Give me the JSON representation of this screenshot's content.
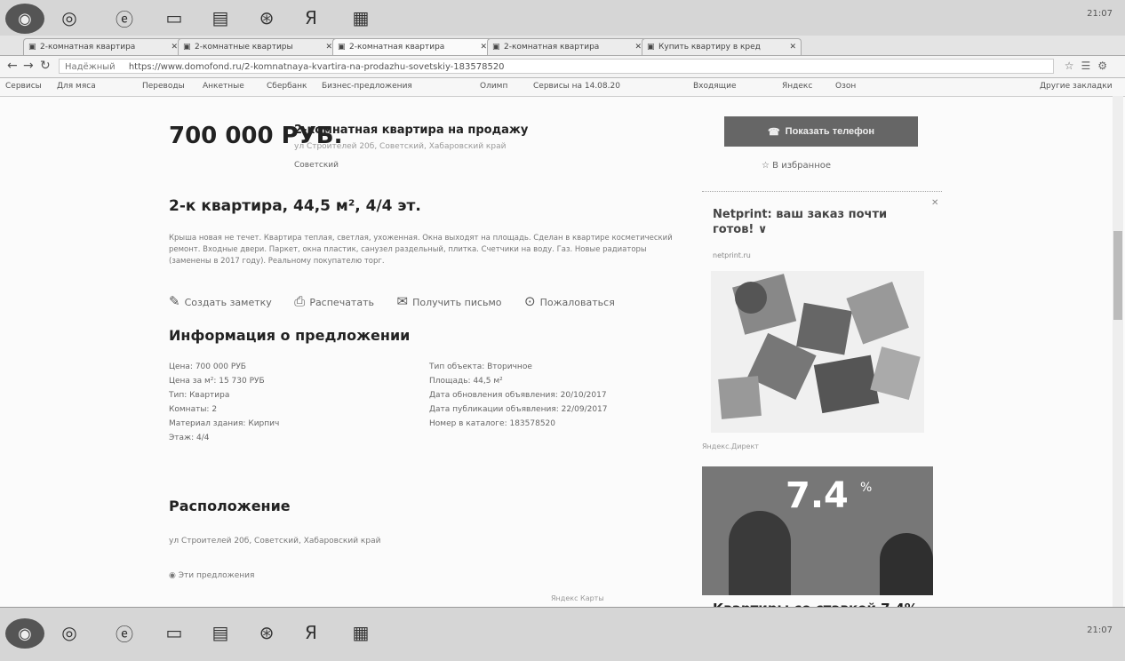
{
  "taskbar": {
    "icons": [
      "start-orb",
      "chrome",
      "ie",
      "folder",
      "word",
      "media",
      "yandex",
      "excel"
    ],
    "clock": "21:07",
    "tray": ""
  },
  "tabs": [
    {
      "label": "2-комнатная квартира"
    },
    {
      "label": "2-комнатные квартиры"
    },
    {
      "label": "2-комнатная квартира"
    },
    {
      "label": "2-комнатная квартира"
    },
    {
      "label": "Купить квартиру в кред"
    }
  ],
  "window_label": "",
  "address": {
    "security": "Надёжный",
    "url": "https://www.domofond.ru/2-komnatnaya-kvartira-na-prodazhu-sovetskiy-183578520"
  },
  "bookmarks": [
    "Сервисы",
    "Для мяса",
    "Переводы",
    "Анкетные",
    "Сбербанк",
    "Бизнес-предложения",
    "Олимп",
    "Сервисы на 14.08.20",
    "Входящие",
    "Яндекс",
    "Озон",
    "Другие закладки"
  ],
  "listing": {
    "price": "700 000 РУБ.",
    "headline": "2-комнатная квартира на продажу",
    "sub_address": "ул Строителей 20б, Советский, Хабаровский край",
    "district": "Советский",
    "primary_button": "Показать телефон",
    "favorite": "В избранное",
    "title": "2-к квартира, 44,5 м², 4/4 эт.",
    "description": "Крыша новая не течет. Квартира теплая, светлая, ухоженная. Окна выходят на площадь. Сделан в квартире косметический ремонт. Входные двери. Паркет, окна пластик, санузел раздельный, плитка. Счетчики на воду. Газ. Новые радиаторы (заменены в 2017 году). Реальному покупателю торг.",
    "actions": [
      {
        "icon": "note-icon",
        "label": "Создать заметку"
      },
      {
        "icon": "print-icon",
        "label": "Распечатать"
      },
      {
        "icon": "share-icon",
        "label": "Получить письмо"
      },
      {
        "icon": "report-icon",
        "label": "Пожаловаться"
      }
    ],
    "info_title": "Информация о предложении",
    "info_left": [
      "Цена: 700 000 РУБ",
      "Цена за м²: 15 730 РУБ",
      "Тип: Квартира",
      "Комнаты: 2",
      "Материал здания: Кирпич",
      "Этаж: 4/4"
    ],
    "info_right": [
      "Тип объекта: Вторичное",
      "Площадь: 44,5 м²",
      "Дата обновления объявления: 20/10/2017",
      "Дата публикации объявления: 22/09/2017",
      "Номер в каталоге: 183578520"
    ],
    "location_title": "Расположение",
    "location_line": "ул Строителей 20б, Советский, Хабаровский край",
    "other_offers": "Эти предложения",
    "map_stamp": "Яндекс Карты"
  },
  "ad": {
    "title": "Netprint: ваш заказ почти готов! ∨",
    "domain": "netprint.ru",
    "caption": "Яндекс.Директ",
    "banner_rate": "7.4",
    "banner_pct": "%",
    "bottom_text": "Квартиры со ставкой 7,4%"
  }
}
